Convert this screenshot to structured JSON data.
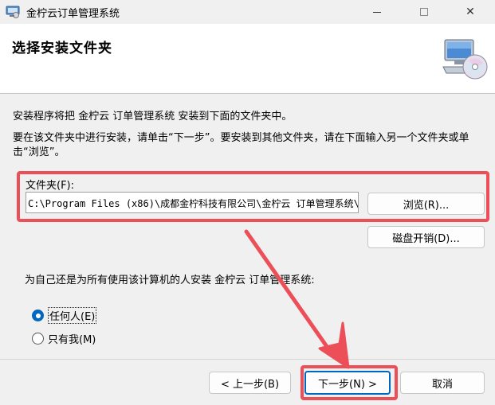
{
  "window": {
    "title": "金柠云订单管理系统",
    "icons": {
      "app": "installer-icon",
      "minimize": "minimize-icon",
      "maximize": "maximize-icon",
      "close": "close-icon"
    },
    "close_glyph": "✕"
  },
  "header": {
    "title": "选择安装文件夹",
    "graphic": "computer-cd-icon"
  },
  "body": {
    "intro": "安装程序将把 金柠云 订单管理系统 安装到下面的文件夹中。",
    "instructions": "要在该文件夹中进行安装，请单击“下一步”。要安装到其他文件夹，请在下面输入另一个文件夹或单击“浏览”。",
    "folder_label": "文件夹(F):",
    "folder_value": "C:\\Program Files (x86)\\成都金柠科技有限公司\\金柠云 订单管理系统\\",
    "browse_label": "浏览(R)...",
    "disk_label": "磁盘开销(D)...",
    "who_text": "为自己还是为所有使用该计算机的人安装 金柠云 订单管理系统:",
    "radio_options": [
      {
        "label": "任何人(E)",
        "checked": true
      },
      {
        "label": "只有我(M)",
        "checked": false
      }
    ]
  },
  "footer": {
    "prev_label": "< 上一步(B)",
    "next_label": "下一步(N) >",
    "cancel_label": "取消"
  },
  "colors": {
    "annotation_red": "#ec4f57",
    "accent_blue": "#0067c0"
  }
}
